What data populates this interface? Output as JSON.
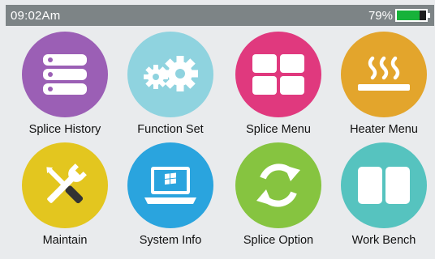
{
  "status": {
    "time": "09:02Am",
    "battery_text": "79%",
    "battery_level": 0.79,
    "battery_color": "#17b23a"
  },
  "menu": [
    {
      "label": "Splice History",
      "icon": "database-icon",
      "color": "#9b5fb5"
    },
    {
      "label": "Function Set",
      "icon": "gears-icon",
      "color": "#8fd3df"
    },
    {
      "label": "Splice Menu",
      "icon": "window-grid-icon",
      "color": "#e0397e"
    },
    {
      "label": "Heater Menu",
      "icon": "heater-icon",
      "color": "#e3a52c"
    },
    {
      "label": "Maintain",
      "icon": "tools-icon",
      "color": "#e3c61f"
    },
    {
      "label": "System Info",
      "icon": "laptop-icon",
      "color": "#2aa4de"
    },
    {
      "label": "Splice Option",
      "icon": "refresh-icon",
      "color": "#86c440"
    },
    {
      "label": "Work Bench",
      "icon": "split-panel-icon",
      "color": "#56c3bf"
    }
  ]
}
